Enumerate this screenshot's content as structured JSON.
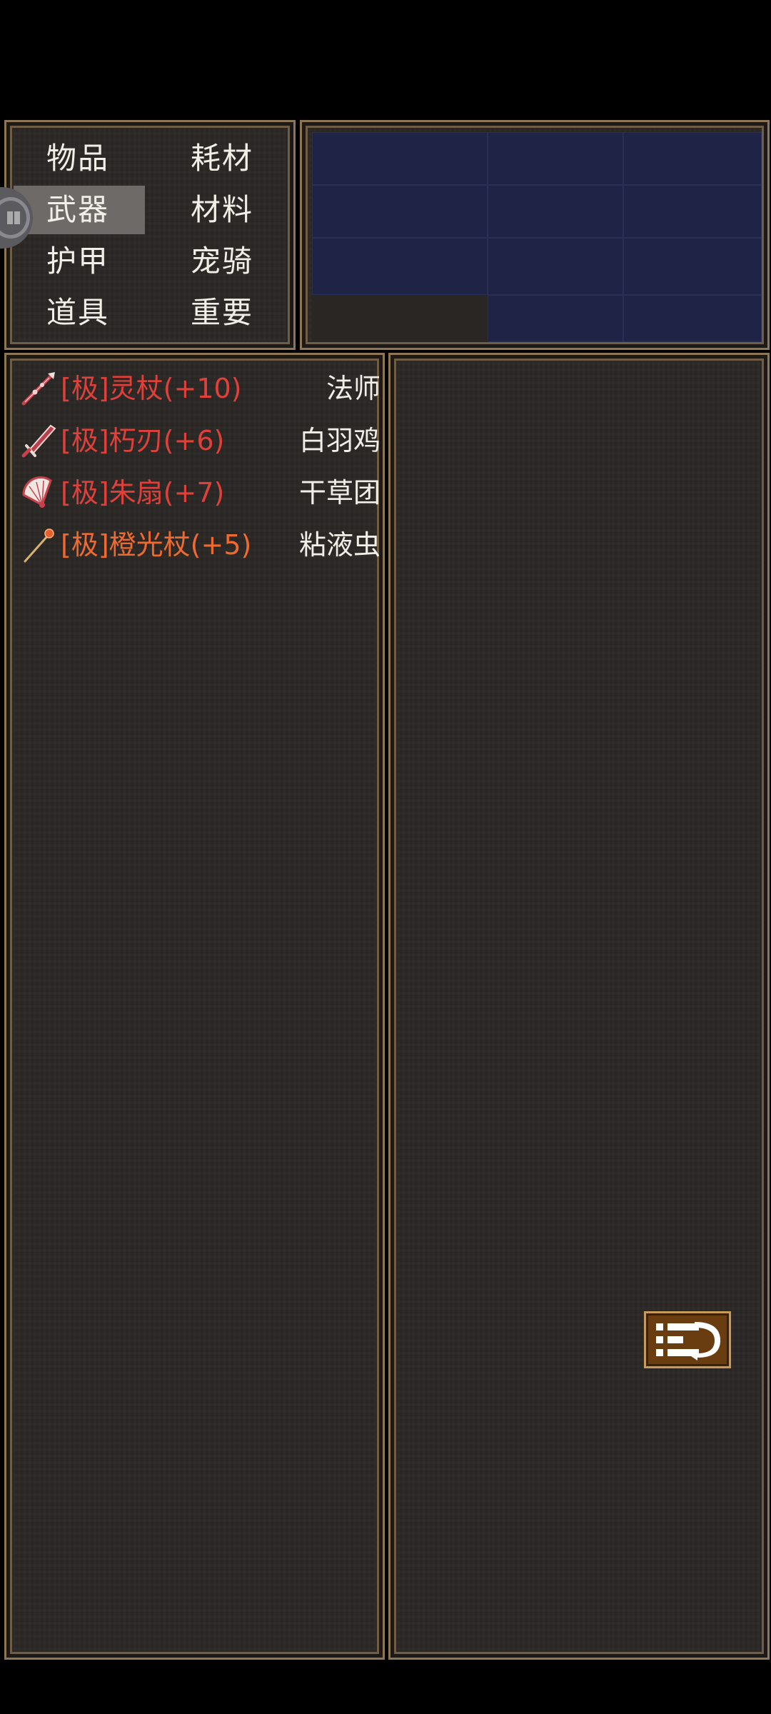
{
  "categories": [
    {
      "label": "物品",
      "selected": false
    },
    {
      "label": "耗材",
      "selected": false
    },
    {
      "label": "武器",
      "selected": true
    },
    {
      "label": "材料",
      "selected": false
    },
    {
      "label": "护甲",
      "selected": false
    },
    {
      "label": "宠骑",
      "selected": false
    },
    {
      "label": "道具",
      "selected": false
    },
    {
      "label": "重要",
      "selected": false
    }
  ],
  "items": [
    {
      "name": "[极]灵杖(+10)",
      "owner": "法师",
      "color": "#e0403a",
      "icon": "spear-icon"
    },
    {
      "name": "[极]朽刃(+6)",
      "owner": "白羽鸡",
      "color": "#e0403a",
      "icon": "blade-icon"
    },
    {
      "name": "[极]朱扇(+7)",
      "owner": "干草团",
      "color": "#e0403a",
      "icon": "fan-icon"
    },
    {
      "name": "[极]橙光杖(+5)",
      "owner": "粘液虫",
      "color": "#ef6a30",
      "icon": "orange-staff-icon"
    }
  ],
  "colors": {
    "slot": "#1f2447",
    "panel_border": "#8c7655",
    "selected_tab": "#6e6a68"
  },
  "return_button": {
    "icon": "return-icon"
  }
}
